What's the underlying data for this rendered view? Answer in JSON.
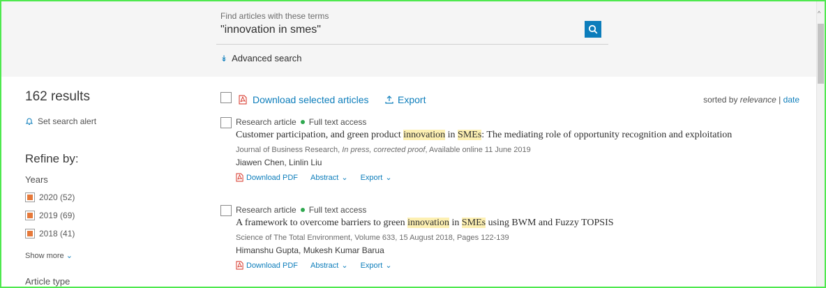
{
  "search": {
    "label": "Find articles with these terms",
    "value": "\"innovation in smes\"",
    "advanced": "Advanced search"
  },
  "sidebar": {
    "results_count": "162 results",
    "alert": "Set search alert",
    "refine": "Refine by:",
    "years_label": "Years",
    "years": [
      {
        "label": "2020 (52)"
      },
      {
        "label": "2019 (69)"
      },
      {
        "label": "2018 (41)"
      }
    ],
    "show_more": "Show more",
    "article_type": "Article type"
  },
  "toolbar": {
    "download_selected": "Download selected articles",
    "export": "Export",
    "sorted_by": "sorted by",
    "relevance": "relevance",
    "separator": "|",
    "date": "date"
  },
  "results": [
    {
      "type": "Research article",
      "access": "Full text access",
      "title_parts": [
        "Customer participation, and green product ",
        "innovation",
        " in ",
        "SMEs",
        ": The mediating role of opportunity recognition and exploitation"
      ],
      "journal": "Journal of Business Research, ",
      "journal_status": "In press, corrected proof",
      "journal_tail": ", Available online 11 June 2019",
      "authors": "Jiawen Chen, Linlin Liu",
      "download": "Download PDF",
      "abstract": "Abstract",
      "export": "Export"
    },
    {
      "type": "Research article",
      "access": "Full text access",
      "title_parts": [
        "A framework to overcome barriers to green ",
        "innovation",
        " in ",
        "SMEs",
        " using BWM and Fuzzy TOPSIS"
      ],
      "journal": "Science of The Total Environment, Volume 633, 15 August 2018, Pages 122-139",
      "authors": "Himanshu Gupta, Mukesh Kumar Barua",
      "download": "Download PDF",
      "abstract": "Abstract",
      "export": "Export"
    }
  ],
  "colors": {
    "accent": "#0c7dbb",
    "highlight": "#fdf0b2",
    "checkbox_fill": "#e6793a",
    "access_dot": "#2fa84f"
  }
}
